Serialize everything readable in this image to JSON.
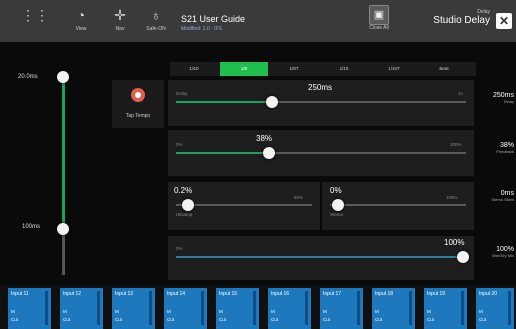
{
  "topbar": {
    "buttons": [
      {
        "icon": "routing-icon",
        "glyph": "⋮⋮",
        "label": ""
      },
      {
        "icon": "view-icon",
        "glyph": "◔",
        "label": "View"
      },
      {
        "icon": "nav-icon",
        "glyph": "✛",
        "label": "Nav"
      },
      {
        "icon": "safe-icon",
        "glyph": "♁",
        "label": "Safe-ON"
      }
    ],
    "title": "S21 User Guide",
    "subtitle": "Modified: 1.0 · IFS",
    "close_all_label": "Close All",
    "effect_type": "Delay",
    "effect_name": "Studio Delay",
    "close_glyph": "✕"
  },
  "left_fader": {
    "top_label": "20.0ms",
    "bottom_label": "100ms"
  },
  "tap": {
    "label": "Tap Tempo"
  },
  "tabs": [
    "1/4D",
    "1/8",
    "1/8T",
    "1/16",
    "1/16T",
    "Beat"
  ],
  "params": {
    "delay": {
      "name": "Delay",
      "value": "250ms",
      "max": "1s",
      "side_value": "250ms",
      "side_label": "Delay"
    },
    "feedback": {
      "name": "0%",
      "value": "38%",
      "max": "100%",
      "side_value": "38%",
      "side_label": "Feedback"
    },
    "hi_damp": {
      "name": "HiDamp",
      "value": "0.2%",
      "max": "50%",
      "side_value": "",
      "side_label": ""
    },
    "stereo": {
      "name": "Stereo",
      "value": "0%",
      "max": "100%",
      "side_value": "0ms",
      "side_label": "Stereo Skew"
    },
    "mix": {
      "name": "0%",
      "value": "100%",
      "max": "",
      "side_value": "100%",
      "side_label": "Wet/Dry Mix"
    }
  },
  "channels": [
    {
      "name": "Input 11",
      "m1": "M",
      "m2": "Cut"
    },
    {
      "name": "Input 12",
      "m1": "M",
      "m2": "Cut"
    },
    {
      "name": "Input 13",
      "m1": "M",
      "m2": "Cut"
    },
    {
      "name": "Input 14",
      "m1": "M",
      "m2": "Cut"
    },
    {
      "name": "Input 15",
      "m1": "M",
      "m2": "Cut"
    },
    {
      "name": "Input 16",
      "m1": "M",
      "m2": "Cut"
    },
    {
      "name": "Input 17",
      "m1": "M",
      "m2": "Cut"
    },
    {
      "name": "Input 18",
      "m1": "M",
      "m2": "Cut"
    },
    {
      "name": "Input 19",
      "m1": "M",
      "m2": "Cut"
    },
    {
      "name": "Input 20",
      "m1": "M",
      "m2": "Cut"
    }
  ],
  "levels": {
    "delay": 0.33,
    "feedback": 0.32,
    "hi_damp": 0.0,
    "stereo": 0.0,
    "mix": 0.99,
    "left_fader": 0.78
  },
  "colors": {
    "green": "#1fbf4f",
    "blue": "#1d78bd",
    "teal": "#2a7fa0"
  }
}
